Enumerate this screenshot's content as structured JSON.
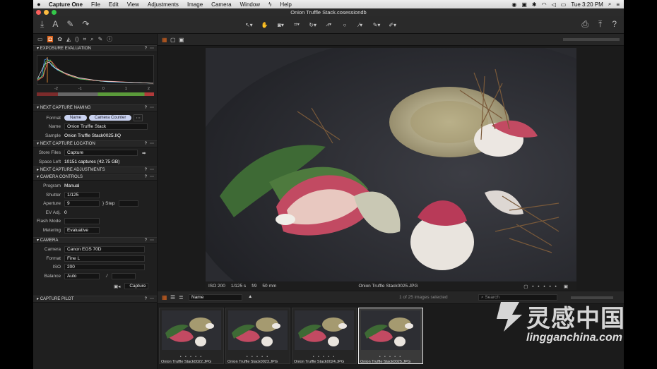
{
  "menubar": {
    "app": "Capture One",
    "items": [
      "File",
      "Edit",
      "View",
      "Adjustments",
      "Image",
      "Camera",
      "Window",
      "Help"
    ],
    "clock": "Tue 3:20 PM"
  },
  "window": {
    "title": "Onion Truffle Stack.cosessiondb"
  },
  "panels": {
    "exposure": {
      "title": "EXPOSURE EVALUATION",
      "scale": [
        "-2",
        "-1",
        "0",
        "1",
        "2"
      ]
    },
    "naming": {
      "title": "NEXT CAPTURE NAMING",
      "format_label": "Format",
      "format_tokens": [
        "Name",
        "Camera Counter"
      ],
      "name_label": "Name",
      "name_value": "Onion Truffle Stack",
      "sample_label": "Sample",
      "sample_value": "Onion Truffle Stack0025.IIQ"
    },
    "location": {
      "title": "NEXT CAPTURE LOCATION",
      "store_label": "Store Files",
      "store_value": "Capture",
      "space_label": "Space Left",
      "space_value": "10151 captures (42.75 GB)"
    },
    "adjustments": {
      "title": "NEXT CAPTURE ADJUSTMENTS"
    },
    "camera_controls": {
      "title": "CAMERA CONTROLS",
      "program_label": "Program",
      "program_value": "Manual",
      "shutter_label": "Shutter",
      "shutter_value": "1/125",
      "aperture_label": "Aperture",
      "aperture_value": "9",
      "step_label": "Step",
      "ev_label": "EV Adj.",
      "ev_value": "0",
      "flash_label": "Flash Mode",
      "metering_label": "Metering",
      "metering_value": "Evaluative"
    },
    "camera": {
      "title": "CAMERA",
      "camera_label": "Camera",
      "camera_value": "Canon EOS 70D",
      "format_label": "Format",
      "format_value": "Fine L",
      "iso_label": "ISO",
      "iso_value": "200",
      "balance_label": "Balance",
      "balance_value": "Auto",
      "capture_button": "Capture"
    },
    "pilot": {
      "title": "CAPTURE PILOT"
    }
  },
  "viewer": {
    "iso": "ISO 200",
    "shutter": "1/125 s",
    "aperture": "f/9",
    "focal": "50 mm",
    "filename": "Onion Truffle Stack0025.JPG"
  },
  "browser": {
    "sort_value": "Name",
    "selection_status": "1 of 25 images selected",
    "search_placeholder": "Search",
    "thumbnails": [
      {
        "name": "Onion Truffle Stack0022.JPG",
        "selected": false
      },
      {
        "name": "Onion Truffle Stack0023.JPG",
        "selected": false
      },
      {
        "name": "Onion Truffle Stack0024.JPG",
        "selected": false
      },
      {
        "name": "Onion Truffle Stack0025.JPG",
        "selected": true
      }
    ]
  },
  "watermark": {
    "chinese": "灵感中国",
    "latin": "lingganchina.com"
  },
  "colors": {
    "accent": "#d9641e",
    "panel": "#1f1f1f",
    "viewer": "#1b1b1b",
    "plate": "#2a2b30",
    "radish": "#c24a62"
  }
}
